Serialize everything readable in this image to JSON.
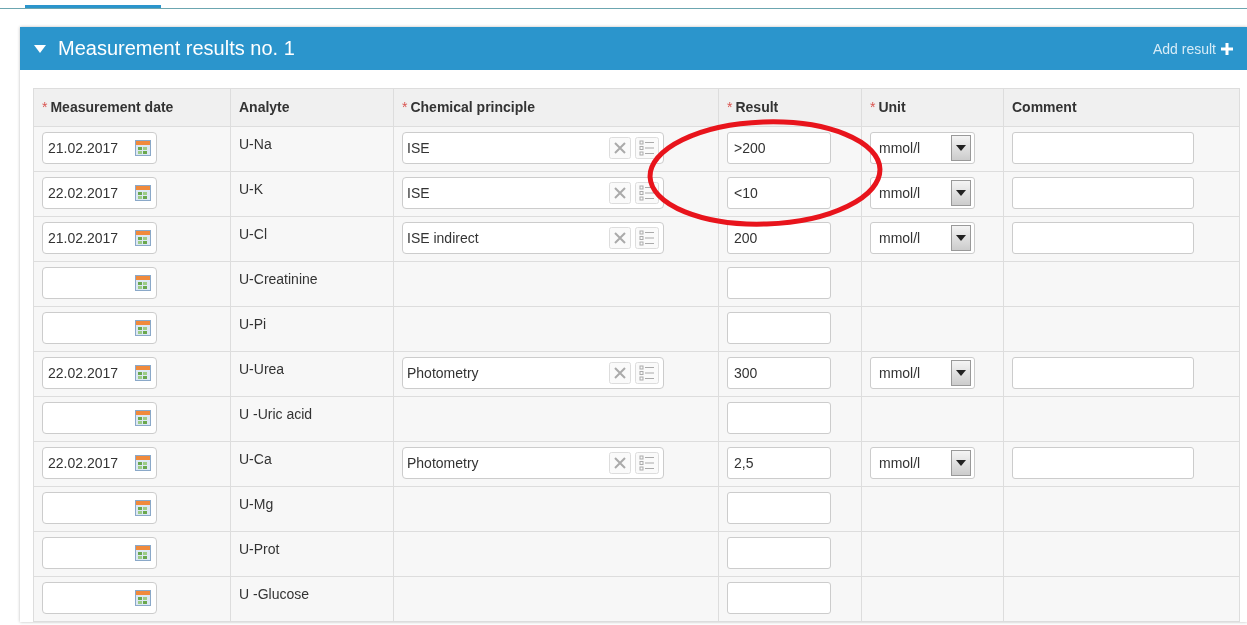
{
  "panel": {
    "title": "Measurement results no. 1",
    "expanded": true,
    "action": "Add result"
  },
  "table": {
    "columns": [
      {
        "label": "Measurement date",
        "marker": "*"
      },
      {
        "label": "Analyte"
      },
      {
        "label": "Chemical principle",
        "marker": "*"
      },
      {
        "label": "Result",
        "marker": "*"
      },
      {
        "label": "Unit",
        "marker": "*"
      },
      {
        "label": "Comment"
      }
    ],
    "rows": [
      {
        "date": "21.02.2017",
        "analyte": "U-Na",
        "principle": "ISE",
        "result": ">200",
        "unit": "mmol/l"
      },
      {
        "date": "22.02.2017",
        "analyte": "U-K",
        "principle": "ISE",
        "result": "<10",
        "unit": "mmol/l"
      },
      {
        "date": "21.02.2017",
        "analyte": "U-Cl",
        "principle": "ISE indirect",
        "result": "200",
        "unit": "mmol/l"
      },
      {
        "analyte": "U-Creatinine"
      },
      {
        "analyte": "U-Pi"
      },
      {
        "date": "22.02.2017",
        "analyte": "U-Urea",
        "principle": "Photometry",
        "result": "300",
        "unit": "mmol/l"
      },
      {
        "analyte": "U -Uric acid"
      },
      {
        "date": "22.02.2017",
        "analyte": "U-Ca",
        "principle": "Photometry",
        "result": "2,5",
        "unit": "mmol/l"
      },
      {
        "analyte": "U-Mg"
      },
      {
        "analyte": "U-Prot"
      },
      {
        "analyte": "U -Glucose"
      }
    ]
  }
}
